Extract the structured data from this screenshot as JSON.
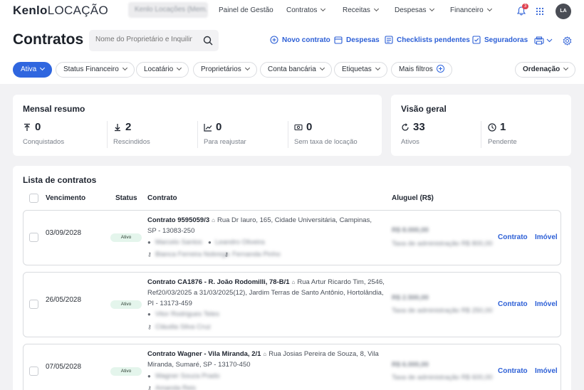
{
  "app": {
    "logo_primary": "Kenlo",
    "logo_secondary": "LOCAÇÃO",
    "company_selector": "Kenlo Locações (Mem...",
    "notification_count": "3",
    "avatar_initials": "LA"
  },
  "nav": {
    "items": [
      "Painel de Gestão",
      "Contratos",
      "Receitas",
      "Despesas",
      "Financeiro"
    ]
  },
  "header": {
    "title": "Contratos",
    "search_placeholder": "Nome do Proprietário e Inquilino",
    "actions": {
      "new_contract": "Novo contrato",
      "expenses": "Despesas",
      "checklists": "Checklists pendentes",
      "insurers": "Seguradoras"
    }
  },
  "filters": {
    "active": "Ativa",
    "financial_status": "Status Financeiro",
    "tenant": "Locatário",
    "owners": "Proprietários",
    "bank_account": "Conta bancária",
    "tags": "Etiquetas",
    "more_filters": "Mais filtros",
    "sort": "Ordenação"
  },
  "monthly_summary": {
    "title": "Mensal resumo",
    "metrics": [
      {
        "value": "0",
        "label": "Conquistados"
      },
      {
        "value": "2",
        "label": "Rescindidos"
      },
      {
        "value": "0",
        "label": "Para reajustar"
      },
      {
        "value": "0",
        "label": "Sem taxa de locação"
      }
    ]
  },
  "overview": {
    "title": "Visão geral",
    "metrics": [
      {
        "value": "33",
        "label": "Ativos"
      },
      {
        "value": "1",
        "label": "Pendente"
      }
    ]
  },
  "contracts_list": {
    "title": "Lista de contratos",
    "columns": {
      "due": "Vencimento",
      "status": "Status",
      "contract": "Contrato",
      "rent": "Aluguel (R$)"
    },
    "link_contract": "Contrato",
    "link_property": "Imóvel",
    "rows": [
      {
        "due": "03/09/2028",
        "status": "Ativo",
        "contract_id": "Contrato 9595059/3",
        "address": "Rua Dr Iauro, 165, Cidade Universitária, Campinas, SP - 13083-250",
        "owner": "Marcelo Santos",
        "tenant": "Leandro Oliveira",
        "key1": "Bianca Ferreira Nobrega",
        "key2": "Fernanda Pinho",
        "rent": "R$ 8.000,00",
        "admin_fee": "Taxa de administração R$ 800,00"
      },
      {
        "due": "26/05/2028",
        "status": "Ativo",
        "contract_id": "Contrato CA1876 - R. João Rodomilli, 78-B/1",
        "address": "Rua Artur Ricardo Tim, 2546, Ref20/03/2025 a 31/03/2025(12), Jardim Terras de Santo Antônio, Hortolândia, PI - 13173-459",
        "owner": "Vitor Rodrigues Teles",
        "tenant": "",
        "key1": "Cláudia Silva Cruz",
        "key2": "",
        "rent": "R$ 2.500,00",
        "admin_fee": "Taxa de administração R$ 250,00"
      },
      {
        "due": "07/05/2028",
        "status": "Ativo",
        "contract_id": "Contrato Wagner - Vila Miranda, 2/1",
        "address": "Rua Josias Pereira de Souza, 8, Vila Miranda, Sumaré, SP - 13170-450",
        "owner": "Wagner Souza Prado",
        "tenant": "",
        "key1": "Amanda Reis",
        "key2": "",
        "rent": "R$ 6.000,00",
        "admin_fee": "Taxa de administração R$ 600,00"
      }
    ]
  },
  "colors": {
    "accent": "#2f66df",
    "link": "#2c5fd6",
    "status_active_bg": "#e4f5ec",
    "badge": "#e0424f"
  }
}
